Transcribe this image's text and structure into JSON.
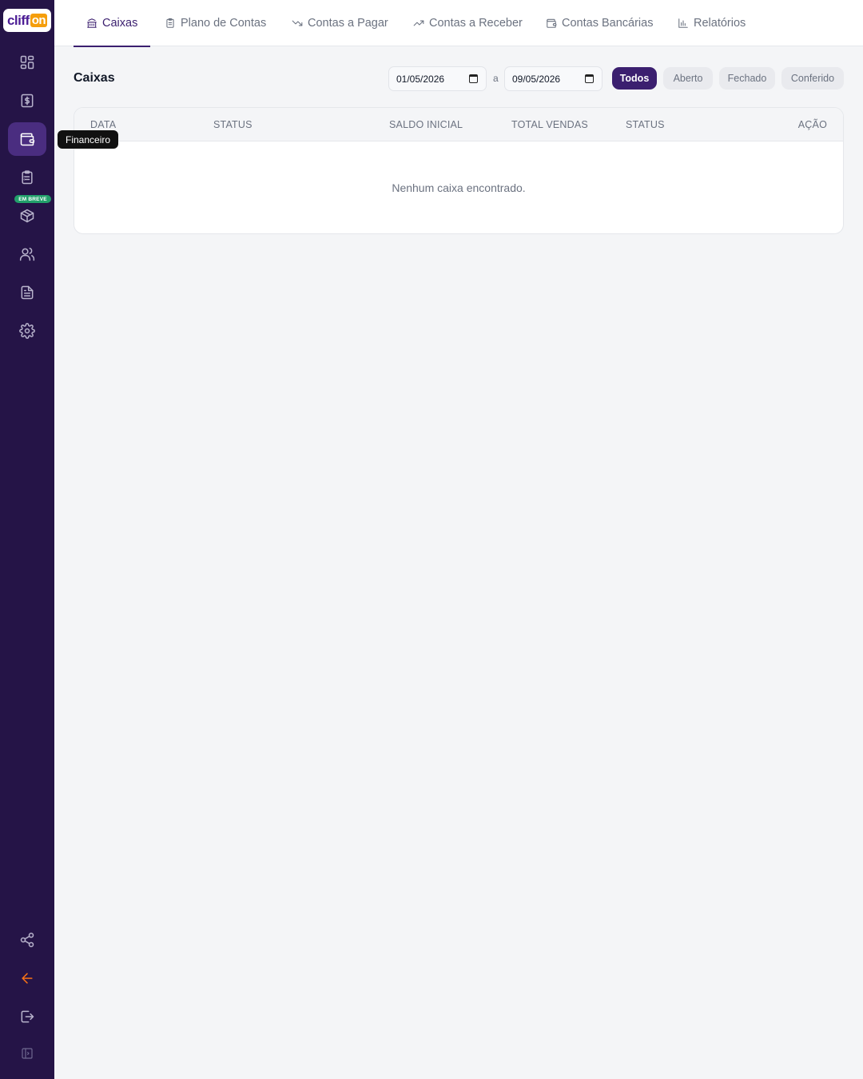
{
  "logo": {
    "part1": "cliff",
    "part2": "on"
  },
  "sidebar": {
    "items": [
      {
        "name": "dashboard",
        "icon": "dashboard-icon"
      },
      {
        "name": "vendas",
        "icon": "dollar-receipt-icon"
      },
      {
        "name": "financeiro",
        "icon": "wallet-icon",
        "active": true
      },
      {
        "name": "pedidos",
        "icon": "clipboard-list-icon"
      },
      {
        "name": "estoque",
        "icon": "package-icon",
        "badge": "EM BREVE"
      },
      {
        "name": "clientes",
        "icon": "users-icon"
      },
      {
        "name": "documentos",
        "icon": "document-icon"
      },
      {
        "name": "configuracoes",
        "icon": "gear-icon"
      }
    ],
    "bottom": [
      {
        "name": "share",
        "icon": "share-icon"
      },
      {
        "name": "back",
        "icon": "arrow-left-icon"
      },
      {
        "name": "logout",
        "icon": "logout-icon"
      },
      {
        "name": "collapse",
        "icon": "sidebar-toggle-icon"
      }
    ],
    "badge": "EM BREVE",
    "tooltip": "Financeiro"
  },
  "tabs": [
    {
      "label": "Caixas",
      "icon": "bank-icon",
      "active": true
    },
    {
      "label": "Plano de Contas",
      "icon": "clipboard-icon"
    },
    {
      "label": "Contas a Pagar",
      "icon": "trending-down-icon"
    },
    {
      "label": "Contas a Receber",
      "icon": "trending-up-icon"
    },
    {
      "label": "Contas Bancárias",
      "icon": "wallet-icon"
    },
    {
      "label": "Relatórios",
      "icon": "bar-chart-icon"
    }
  ],
  "page": {
    "title": "Caixas",
    "date_from": "01/05/2026",
    "date_sep": "a",
    "date_to": "09/05/2026",
    "filters": [
      "Todos",
      "Aberto",
      "Fechado",
      "Conferido"
    ],
    "active_filter": "Todos"
  },
  "table": {
    "columns": [
      "DATA",
      "STATUS",
      "SALDO INICIAL",
      "TOTAL VENDAS",
      "STATUS",
      "AÇÃO"
    ],
    "rows": [],
    "empty_message": "Nenhum caixa encontrado."
  },
  "colors": {
    "sidebar_bg": "#251447",
    "accent": "#3b1f6f",
    "badge_green": "#22a06b",
    "back_orange": "#f97316"
  }
}
